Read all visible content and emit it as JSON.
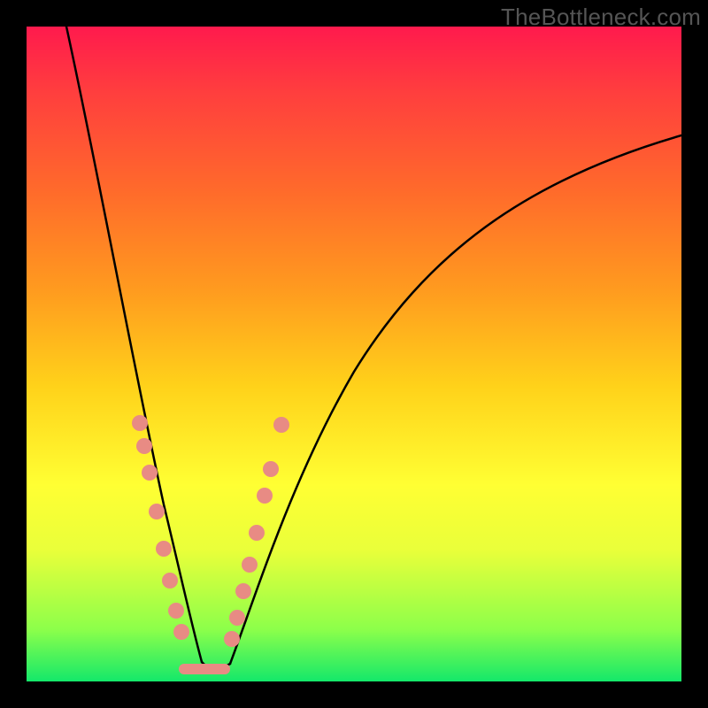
{
  "watermark": "TheBottleneck.com",
  "colors": {
    "background": "#000000",
    "gradient_top": "#ff1a4d",
    "gradient_bottom": "#14e86a",
    "curve": "#000000",
    "marker": "#e88b84"
  },
  "chart_data": {
    "type": "line",
    "title": "",
    "xlabel": "",
    "ylabel": "",
    "xlim": [
      0,
      100
    ],
    "ylim": [
      0,
      100
    ],
    "grid": false,
    "legend": false,
    "description": "V-shaped bottleneck curve: steep descent on the left into a flat trough near x≈25, then a long rising curve to the right. Color gradient backdrop encodes value from red (high/bad) through yellow to green (low/good).",
    "series": [
      {
        "name": "left-branch",
        "x": [
          6,
          8,
          10,
          12,
          14,
          16,
          18,
          20,
          22,
          24
        ],
        "y": [
          100,
          87,
          73,
          60,
          48,
          37,
          27,
          18,
          10,
          4
        ]
      },
      {
        "name": "trough",
        "x": [
          24,
          26,
          28,
          30
        ],
        "y": [
          2,
          1,
          1,
          2
        ]
      },
      {
        "name": "right-branch",
        "x": [
          30,
          34,
          40,
          48,
          56,
          64,
          72,
          80,
          88,
          96,
          100
        ],
        "y": [
          4,
          12,
          25,
          40,
          52,
          62,
          70,
          76,
          80,
          83,
          84
        ]
      }
    ],
    "markers": {
      "left_cluster": [
        {
          "x": 15.5,
          "y": 40
        },
        {
          "x": 16.3,
          "y": 36
        },
        {
          "x": 17.0,
          "y": 32
        },
        {
          "x": 18.2,
          "y": 26
        },
        {
          "x": 19.4,
          "y": 20
        },
        {
          "x": 20.3,
          "y": 15
        },
        {
          "x": 21.2,
          "y": 11
        },
        {
          "x": 22.0,
          "y": 8
        }
      ],
      "right_cluster": [
        {
          "x": 30.5,
          "y": 6
        },
        {
          "x": 31.3,
          "y": 9
        },
        {
          "x": 32.2,
          "y": 13
        },
        {
          "x": 33.0,
          "y": 17
        },
        {
          "x": 34.0,
          "y": 22
        },
        {
          "x": 35.2,
          "y": 28
        },
        {
          "x": 36.0,
          "y": 32
        },
        {
          "x": 37.5,
          "y": 39
        }
      ],
      "trough_bar": {
        "x_start": 23,
        "x_end": 29,
        "y": 1.5
      }
    }
  }
}
